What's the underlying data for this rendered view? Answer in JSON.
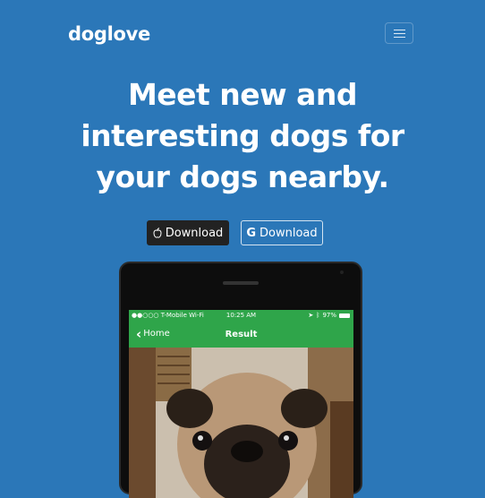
{
  "header": {
    "brand": "doglove",
    "menu_icon": "hamburger-icon"
  },
  "hero": {
    "headline_lines": [
      "Meet new and",
      "interesting dogs for",
      "your dogs nearby."
    ]
  },
  "buttons": {
    "ios": {
      "icon": "apple-icon",
      "label": "Download"
    },
    "android": {
      "icon": "google-icon",
      "glyph": "G",
      "label": "Download"
    }
  },
  "phone": {
    "status": {
      "carrier": "T-Mobile Wi-Fi",
      "time": "10:25 AM",
      "battery": "97%"
    },
    "nav": {
      "back_label": "Home",
      "title": "Result"
    }
  },
  "colors": {
    "background": "#2b77b8",
    "app_green": "#2fa54a",
    "dark_button": "#222222"
  }
}
